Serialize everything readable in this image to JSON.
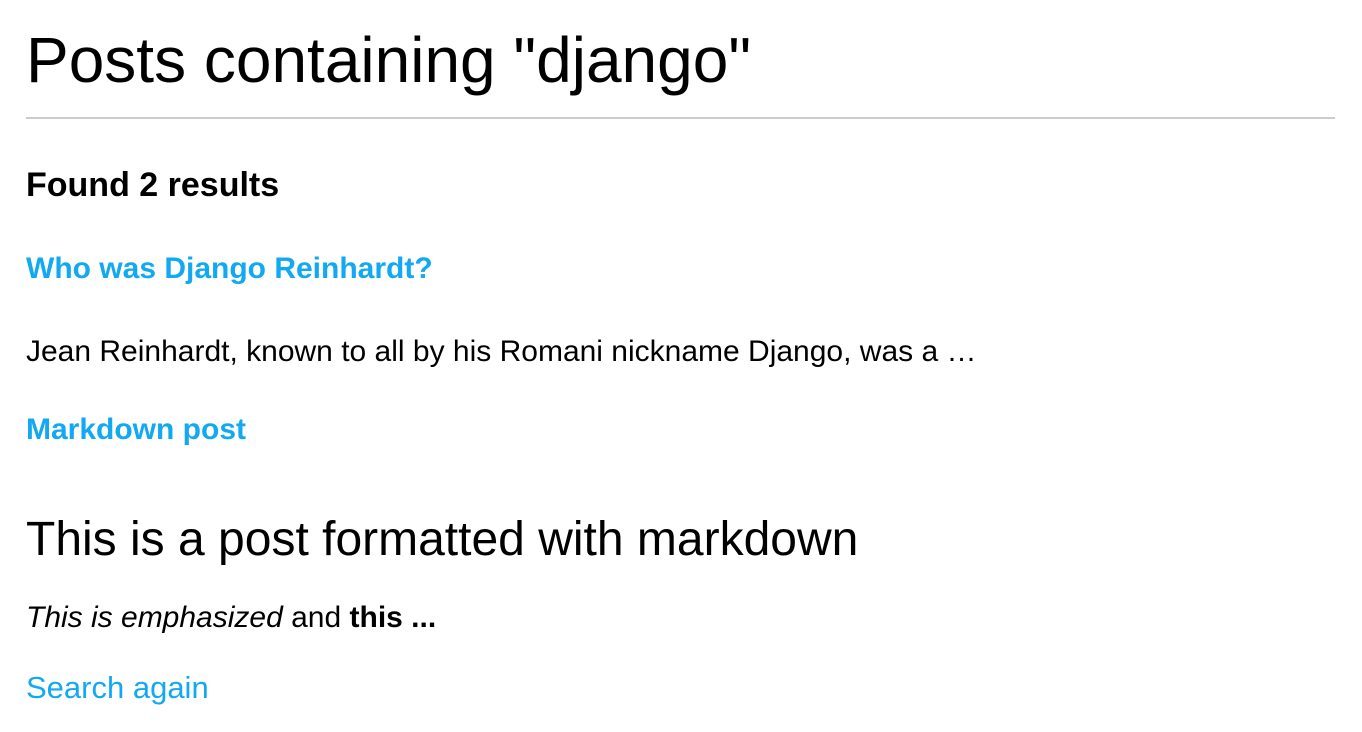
{
  "page": {
    "title": "Posts containing \"django\""
  },
  "results": {
    "count_text": "Found 2 results",
    "items": [
      {
        "title": "Who was Django Reinhardt?",
        "snippet": "Jean Reinhardt, known to all by his Romani nickname Django, was a …"
      },
      {
        "title": "Markdown post",
        "heading": "This is a post formatted with markdown",
        "snippet_emphasized": "This is emphasized",
        "snippet_and": " and ",
        "snippet_bold": "this ..."
      }
    ]
  },
  "footer": {
    "search_again_label": "Search again"
  },
  "colors": {
    "link": "#12a9f2",
    "divider": "#cccccc",
    "text": "#000000"
  }
}
